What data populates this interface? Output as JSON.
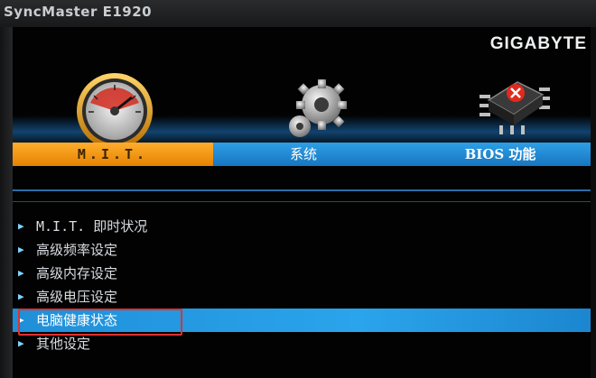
{
  "monitor": {
    "label": "SyncMaster E1920"
  },
  "brand": "GIGABYTE",
  "tabs": [
    {
      "label": "M.I.T.",
      "icon": "speedometer-icon",
      "active": true
    },
    {
      "label": "系统",
      "icon": "gear-icon",
      "active": false
    },
    {
      "label": "BIOS 功能",
      "icon": "chip-icon",
      "active": false
    }
  ],
  "menu": {
    "items": [
      {
        "label": "M.I.T. 即时状况"
      },
      {
        "label": "高级频率设定"
      },
      {
        "label": "高级内存设定"
      },
      {
        "label": "高级电压设定"
      },
      {
        "label": "电脑健康状态",
        "selected": true
      },
      {
        "label": "其他设定"
      }
    ]
  },
  "colors": {
    "active_tab": "#f39a1b",
    "tab_bar": "#1f8fd8",
    "selection": "#2aa4ec",
    "annotation_box": "#e0312e"
  }
}
